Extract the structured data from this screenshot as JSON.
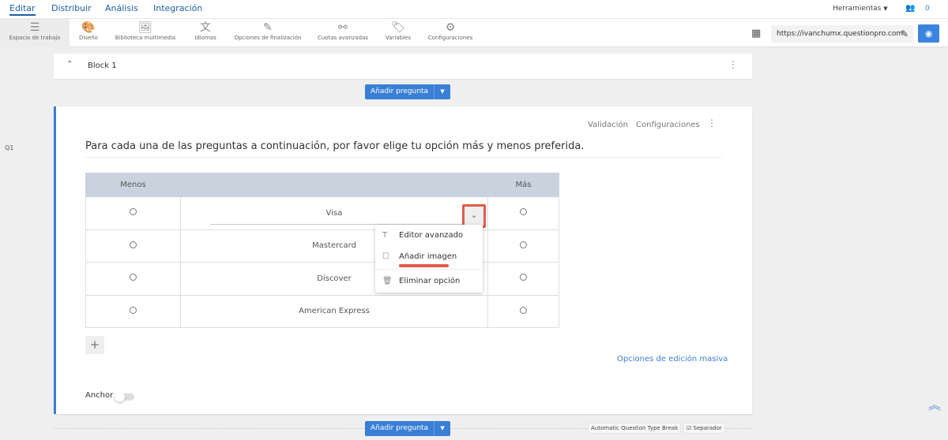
{
  "topnav": {
    "tabs": [
      "Editar",
      "Distribuir",
      "Análisis",
      "Integración"
    ],
    "tools_label": "Herramientas",
    "collab_count": "0"
  },
  "toolbar": {
    "items": [
      {
        "label": "Espacio de trabajo",
        "icon": "workspace-icon"
      },
      {
        "label": "Diseño",
        "icon": "palette-icon"
      },
      {
        "label": "Biblioteca multimedia",
        "icon": "image-icon"
      },
      {
        "label": "Idiomas",
        "icon": "translate-icon"
      },
      {
        "label": "Opciones de finalización",
        "icon": "magic-wand-icon"
      },
      {
        "label": "Cuotas avanzadas",
        "icon": "quota-icon"
      },
      {
        "label": "Variables",
        "icon": "tag-icon"
      },
      {
        "label": "Configuraciones",
        "icon": "gear-icon"
      }
    ],
    "url": "https://ivanchumx.questionpro.com"
  },
  "block": {
    "title": "Block 1",
    "add_question": "Añadir pregunta"
  },
  "question": {
    "number": "Q1",
    "validation": "Validación",
    "settings": "Configuraciones",
    "text": "Para cada una de las preguntas a continuación, por favor elige tu opción más y menos preferida.",
    "col_left": "Menos",
    "col_right": "Más",
    "options": [
      "Visa",
      "Mastercard",
      "Discover",
      "American Express"
    ],
    "bulk_edit": "Opciones de edición masiva",
    "anchor_label": "Anchor"
  },
  "menu": {
    "items": [
      "Editor avanzado",
      "Añadir imagen",
      "Eliminar opción"
    ]
  },
  "footer": {
    "add_question": "Añadir pregunta",
    "auto_break": "Automatic Question Type Break",
    "separator": "Separador"
  }
}
